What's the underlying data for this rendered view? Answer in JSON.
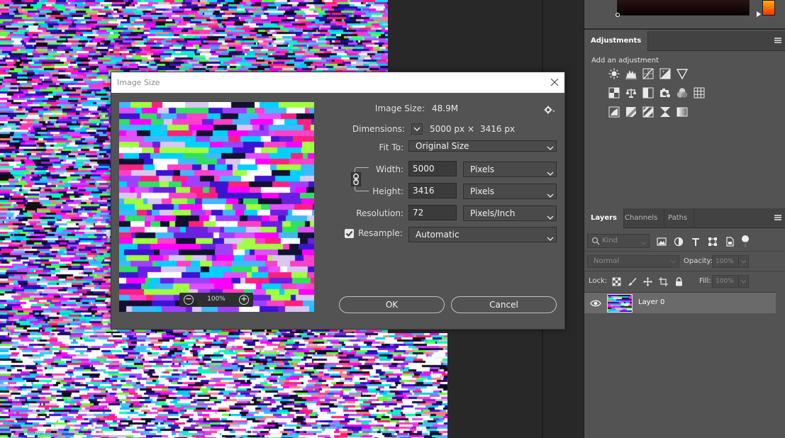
{
  "colors": {
    "app_background": "#282828",
    "panel_background": "#535353",
    "panel_header": "#424242",
    "dialog_titlebar": "#ffffff",
    "selected_layer": "#6a6a6a",
    "text_primary": "#e8e8e8"
  },
  "icons": {
    "adjustments_row1": [
      "brightness-contrast-icon",
      "levels-icon",
      "curves-icon",
      "exposure-icon",
      "gradient-triangle-icon"
    ],
    "adjustments_row2": [
      "vibrance-icon",
      "color-balance-icon",
      "black-white-icon",
      "photo-filter-icon",
      "channel-mixer-icon",
      "color-lookup-icon"
    ],
    "adjustments_row3": [
      "invert-icon",
      "posterize-icon",
      "threshold-icon",
      "selective-color-icon",
      "gradient-map-icon"
    ],
    "layer_filters": [
      "pixel-layer-filter-icon",
      "adjustment-layer-filter-icon",
      "type-layer-filter-icon",
      "shape-layer-filter-icon",
      "smart-object-filter-icon"
    ],
    "locks": [
      "lock-transparent-icon",
      "lock-image-icon",
      "lock-position-icon",
      "lock-artboard-icon",
      "lock-all-icon"
    ]
  },
  "adjustments_panel": {
    "tab": "Adjustments",
    "caption": "Add an adjustment"
  },
  "layers_panel": {
    "tabs": [
      "Layers",
      "Channels",
      "Paths"
    ],
    "filter_placeholder": "Kind",
    "blend_mode": "Normal",
    "opacity_label": "Opacity:",
    "opacity_value": "100%",
    "lock_label": "Lock:",
    "fill_label": "Fill:",
    "fill_value": "100%",
    "layers": [
      {
        "name": "Layer 0",
        "visible": true,
        "selected": true
      }
    ]
  },
  "dialog": {
    "title": "Image Size",
    "image_size_label": "Image Size:",
    "image_size_value": "48.9M",
    "dimensions_label": "Dimensions:",
    "dimensions_width": "5000 px",
    "dimensions_times": "×",
    "dimensions_height": "3416 px",
    "fit_to_label": "Fit To:",
    "fit_to_value": "Original Size",
    "width_label": "Width:",
    "width_value": "5000",
    "width_unit": "Pixels",
    "height_label": "Height:",
    "height_value": "3416",
    "height_unit": "Pixels",
    "resolution_label": "Resolution:",
    "resolution_value": "72",
    "resolution_unit": "Pixels/Inch",
    "resample_label": "Resample:",
    "resample_checked": true,
    "resample_value": "Automatic",
    "preview_zoom": "100%",
    "ok_label": "OK",
    "cancel_label": "Cancel"
  }
}
